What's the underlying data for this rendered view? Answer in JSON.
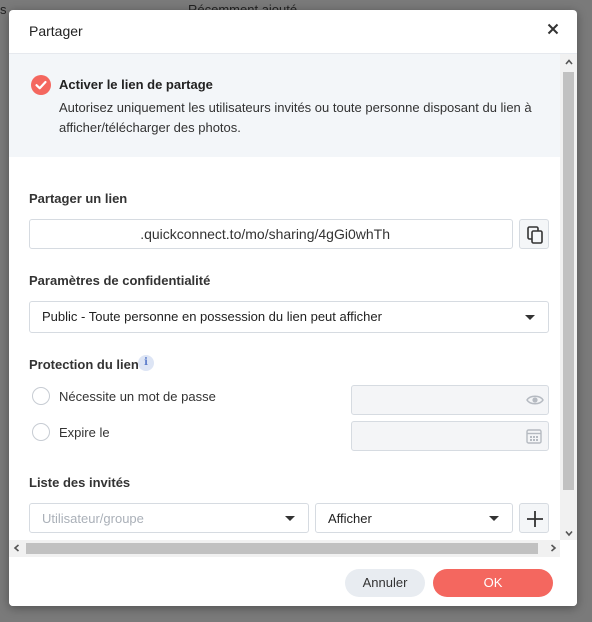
{
  "background": {
    "left_fragment": "s",
    "center_fragment": "Récemment ajouté"
  },
  "dialog": {
    "title": "Partager",
    "close_icon": "close-icon"
  },
  "banner": {
    "title": "Activer le lien de partage",
    "description": "Autorisez uniquement les utilisateurs invités ou toute personne disposant du lien à afficher/télécharger des photos.",
    "checked": true,
    "accent_color": "#f4675f"
  },
  "share_link": {
    "label": "Partager un lien",
    "value": ".quickconnect.to/mo/sharing/4gGi0whTh",
    "copy_icon": "copy-icon"
  },
  "privacy": {
    "label": "Paramètres de confidentialité",
    "selected": "Public - Toute personne en possession du lien peut afficher"
  },
  "protection": {
    "label": "Protection du lien",
    "info_icon": "info-icon",
    "info_glyph": "i",
    "password_option": "Nécessite un mot de passe",
    "password_value": "",
    "expire_option": "Expire le",
    "expire_value": ""
  },
  "invitees": {
    "label": "Liste des invités",
    "user_placeholder": "Utilisateur/groupe",
    "permission": "Afficher",
    "add_icon": "plus-icon"
  },
  "footer": {
    "cancel_label": "Annuler",
    "ok_label": "OK"
  }
}
